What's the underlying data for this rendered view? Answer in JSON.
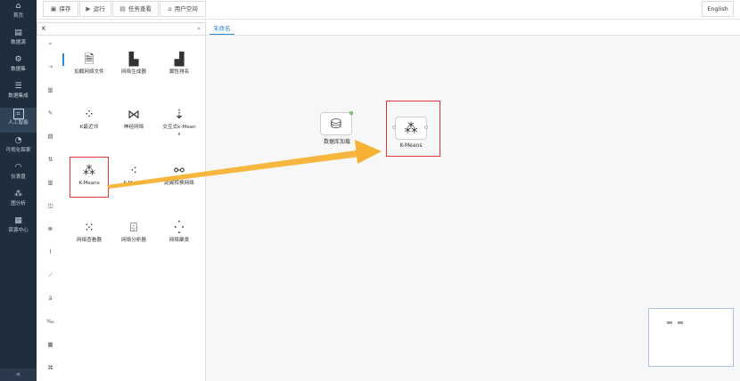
{
  "nav": {
    "items": [
      {
        "icon": "home-icon",
        "glyph": "⌂",
        "label": "首页"
      },
      {
        "icon": "datasource-icon",
        "glyph": "▤",
        "label": "数据源"
      },
      {
        "icon": "dataset-icon",
        "glyph": "⚙",
        "label": "数据集"
      },
      {
        "icon": "data-integration-icon",
        "glyph": "☰",
        "label": "数据集成"
      },
      {
        "icon": "ai-icon",
        "glyph": "⌗",
        "label": "人工智能"
      },
      {
        "icon": "visual-explore-icon",
        "glyph": "◔",
        "label": "可视化探索"
      },
      {
        "icon": "dashboard-icon",
        "glyph": "◠",
        "label": "仪表盘"
      },
      {
        "icon": "graph-analysis-icon",
        "glyph": "⁂",
        "label": "图分析"
      },
      {
        "icon": "resource-center-icon",
        "glyph": "▦",
        "label": "资源中心"
      }
    ],
    "collapse_glyph": "«"
  },
  "toolbar": {
    "save": {
      "glyph": "▣",
      "label": "保存"
    },
    "run": {
      "glyph": "▶",
      "label": "运行"
    },
    "tasks": {
      "glyph": "▤",
      "label": "任务查看"
    },
    "user_space": {
      "glyph": "⌂",
      "label": "用户空间"
    },
    "language": "English"
  },
  "palette": {
    "search_value": "K",
    "search_glyph": "⌕",
    "categories": [
      "⌕",
      "⇢",
      "▥",
      "✎",
      "▤",
      "⇅",
      "▥",
      "◫",
      "≣",
      "⌇",
      "⟋",
      "ä",
      "‰",
      "▦",
      "⌘"
    ],
    "components": [
      {
        "icon": "load-network-file-icon",
        "glyph": "🗎",
        "name": "加载网络文件"
      },
      {
        "icon": "network-generator-icon",
        "glyph": "▙",
        "name": "网络生成器"
      },
      {
        "icon": "attribute-sort-icon",
        "glyph": "▟",
        "name": "属性排名"
      },
      {
        "icon": "k-nearest-icon",
        "glyph": "⁘",
        "name": "K最近邻"
      },
      {
        "icon": "neural-network-icon",
        "glyph": "⋈",
        "name": "神经网络"
      },
      {
        "icon": "interactive-kmeans-icon",
        "glyph": "⇣",
        "name": "交互式k-Means"
      },
      {
        "icon": "kmeans-icon",
        "glyph": "⁂",
        "name": "K-Means"
      },
      {
        "icon": "kmodes-icon",
        "glyph": "⁖",
        "name": "K-Modes"
      },
      {
        "icon": "distance-to-network-icon",
        "glyph": "⚯",
        "name": "距离转换网络"
      },
      {
        "icon": "network-explorer-icon",
        "glyph": "⁙",
        "name": "网络查看器"
      },
      {
        "icon": "network-analyzer-icon",
        "glyph": "⌹",
        "name": "网络分析器"
      },
      {
        "icon": "network-cluster-icon",
        "glyph": "⁛",
        "name": "网络聚类"
      }
    ]
  },
  "canvas": {
    "tab": "未命名",
    "nodes": [
      {
        "icon": "database-icon",
        "glyph": "⛁",
        "label": "数据库加载"
      },
      {
        "icon": "kmeans-node-icon",
        "glyph": "⁂",
        "label": "K-Means"
      }
    ]
  },
  "colors": {
    "nav_bg": "#1f2d3d",
    "accent": "#2f88d8",
    "highlight": "#e3393c",
    "arrow": "#f7b233"
  }
}
